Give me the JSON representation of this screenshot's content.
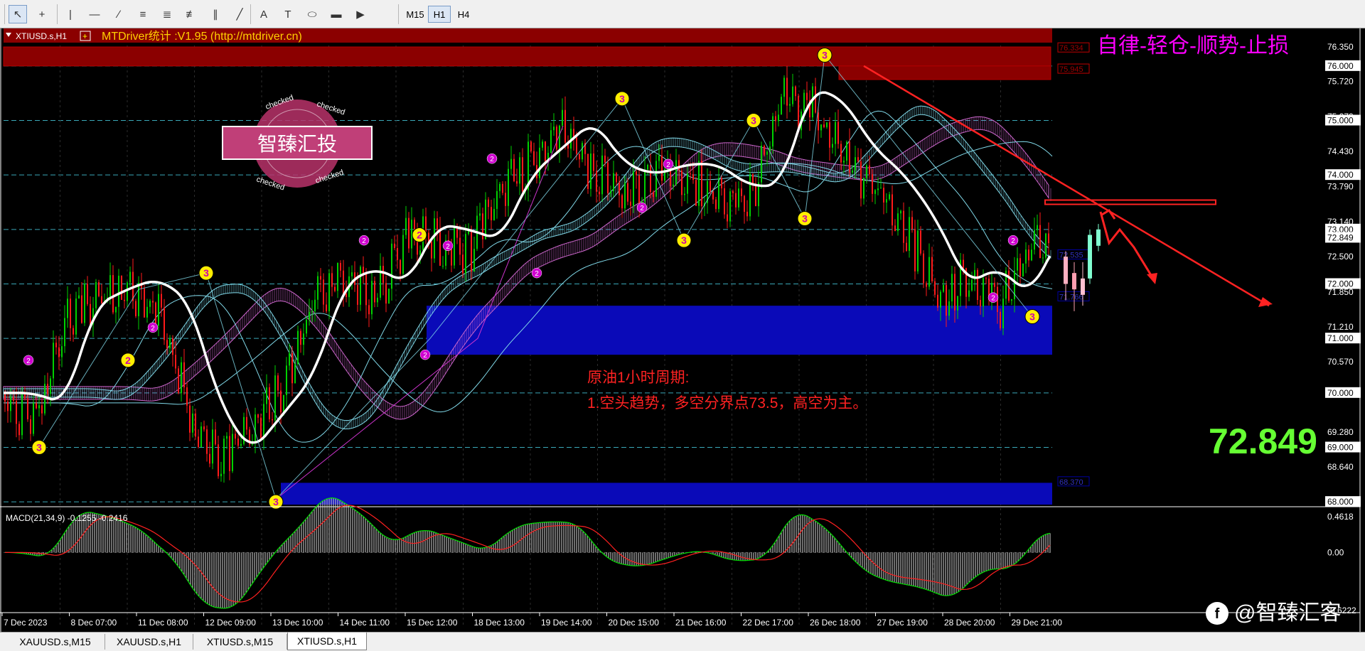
{
  "toolbar": {
    "tools": [
      {
        "name": "cursor-icon",
        "glyph": "↖",
        "active": true
      },
      {
        "name": "crosshair-icon",
        "glyph": "+",
        "active": false
      },
      {
        "name": "vertical-line-icon",
        "glyph": "|",
        "active": false
      },
      {
        "name": "horizontal-line-icon",
        "glyph": "—",
        "active": false
      },
      {
        "name": "trendline-icon",
        "glyph": "∕",
        "active": false
      },
      {
        "name": "equidistant-channel-icon",
        "glyph": "≡",
        "active": false
      },
      {
        "name": "fibonacci-retracement-icon",
        "glyph": "≣",
        "active": false
      },
      {
        "name": "fibonacci-fan-icon",
        "glyph": "≢",
        "active": false
      },
      {
        "name": "fibonacci-time-icon",
        "glyph": "∥",
        "active": false
      },
      {
        "name": "gann-line-icon",
        "glyph": "╱",
        "active": false
      },
      {
        "name": "text-icon",
        "glyph": "A",
        "active": false
      },
      {
        "name": "text-label-icon",
        "glyph": "T",
        "active": false
      },
      {
        "name": "ellipse-icon",
        "glyph": "⬭",
        "active": false
      },
      {
        "name": "rectangle-icon",
        "glyph": "▬",
        "active": false
      },
      {
        "name": "triangle-icon",
        "glyph": "▶",
        "active": false
      }
    ],
    "timeframes": [
      {
        "label": "M15",
        "active": false
      },
      {
        "label": "H1",
        "active": true
      },
      {
        "label": "H4",
        "active": false
      }
    ]
  },
  "chart": {
    "symbol_label": "XTIUSD.s,H1",
    "indicator_title": "MTDriver统计 :V1.95 (http://mtdriver.cn)",
    "motto": "自律-轻仓-顺势-止损",
    "stamp_text": "智臻汇投",
    "stamp_ring": "checked",
    "annotation_title": "原油1小时周期:",
    "annotation_body": "1.空头趋势，多空分界点73.5，高空为主。",
    "big_price": "72.849",
    "watermark": "@智臻汇客",
    "macd_label": "MACD(21,34,9) -0.1255 -0.2416",
    "price_labels": [
      "76.350",
      "76.000",
      "75.720",
      "75.070",
      "75.000",
      "74.430",
      "74.000",
      "73.790",
      "73.140",
      "73.000",
      "72.849",
      "72.500",
      "72.000",
      "71.850",
      "71.210",
      "71.000",
      "70.570",
      "70.000",
      "69.280",
      "69.000",
      "68.640",
      "68.000"
    ],
    "macd_scale": [
      "0.4618",
      "0.00",
      "-0.6222"
    ],
    "time_labels": [
      "7 Dec 2023",
      "8 Dec 07:00",
      "11 Dec 08:00",
      "12 Dec 09:00",
      "13 Dec 10:00",
      "14 Dec 11:00",
      "15 Dec 12:00",
      "18 Dec 13:00",
      "19 Dec 14:00",
      "20 Dec 15:00",
      "21 Dec 16:00",
      "22 Dec 17:00",
      "26 Dec 18:00",
      "27 Dec 19:00",
      "28 Dec 20:00",
      "29 Dec 21:00"
    ],
    "zone_labels": [
      "76.334",
      "75.945",
      "72.535",
      "71.766",
      "68.370"
    ],
    "colors": {
      "bull": "#00d000",
      "bear": "#ff1a1a",
      "sma_white": "#ffffff",
      "band_purple": "#cc66cc",
      "band_cyan": "#80d8e8",
      "zone_blue": "#0a0ab8",
      "zone_red": "#8b0000",
      "grid": "#3aa8b8",
      "motto": "#ff00ff",
      "annotation": "#ff2222",
      "big_price": "#66ff33"
    }
  },
  "chart_data": {
    "type": "candlestick",
    "symbol": "XTIUSD.s",
    "timeframe": "H1",
    "ylim": [
      67.95,
      76.65
    ],
    "dates": [
      "7 Dec 2023",
      "8 Dec 07:00",
      "11 Dec 08:00",
      "12 Dec 09:00",
      "13 Dec 10:00",
      "14 Dec 11:00",
      "15 Dec 12:00",
      "18 Dec 13:00",
      "19 Dec 14:00",
      "20 Dec 15:00",
      "21 Dec 16:00",
      "22 Dec 17:00",
      "26 Dec 18:00",
      "27 Dec 19:00",
      "28 Dec 20:00",
      "29 Dec 21:00"
    ],
    "close_path": [
      70.0,
      69.8,
      71.6,
      71.9,
      72.1,
      71.7,
      69.8,
      68.9,
      69.6,
      70.3,
      72.0,
      72.3,
      72.0,
      73.1,
      73.0,
      72.8,
      74.0,
      74.5,
      75.0,
      74.2,
      74.0,
      74.2,
      74.2,
      73.8,
      73.8,
      75.6,
      75.4,
      74.5,
      74.0,
      73.2,
      72.0,
      72.3,
      71.8,
      72.9
    ],
    "last_price": 72.849,
    "support_zones": [
      [
        70.7,
        71.6
      ],
      [
        67.95,
        68.35
      ]
    ],
    "resistance_zones": [
      [
        76.0,
        76.35
      ],
      [
        75.75,
        76.0
      ]
    ],
    "pivot_line": 73.5,
    "swing_points": [
      {
        "label": "3",
        "x_index": 0,
        "price": 69.0
      },
      {
        "label": "2",
        "x_index": 0,
        "price": 70.6
      },
      {
        "label": "3",
        "x_index": 2,
        "price": 72.2
      },
      {
        "label": "3",
        "x_index": 4,
        "price": 68.0
      },
      {
        "label": "2",
        "x_index": 5,
        "price": 72.9
      },
      {
        "label": "3",
        "x_index": 9,
        "price": 75.4
      },
      {
        "label": "3",
        "x_index": 10,
        "price": 72.8
      },
      {
        "label": "3",
        "x_index": 11,
        "price": 75.0
      },
      {
        "label": "3",
        "x_index": 11,
        "price": 73.2
      },
      {
        "label": "3",
        "x_index": 12,
        "price": 76.2
      },
      {
        "label": "3",
        "x_index": 15,
        "price": 71.4
      }
    ],
    "macd": {
      "fast": 21,
      "slow": 34,
      "signal": 9,
      "main": -0.1255,
      "signal_value": -0.2416,
      "ylim": [
        -0.6222,
        0.4618
      ]
    }
  }
}
